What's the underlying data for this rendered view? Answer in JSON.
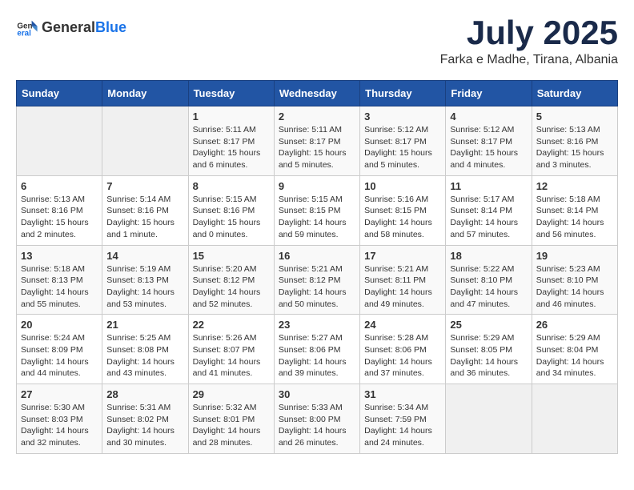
{
  "header": {
    "logo_general": "General",
    "logo_blue": "Blue",
    "month_title": "July 2025",
    "subtitle": "Farka e Madhe, Tirana, Albania"
  },
  "days_of_week": [
    "Sunday",
    "Monday",
    "Tuesday",
    "Wednesday",
    "Thursday",
    "Friday",
    "Saturday"
  ],
  "weeks": [
    [
      {
        "day": "",
        "info": ""
      },
      {
        "day": "",
        "info": ""
      },
      {
        "day": "1",
        "info": "Sunrise: 5:11 AM\nSunset: 8:17 PM\nDaylight: 15 hours\nand 6 minutes."
      },
      {
        "day": "2",
        "info": "Sunrise: 5:11 AM\nSunset: 8:17 PM\nDaylight: 15 hours\nand 5 minutes."
      },
      {
        "day": "3",
        "info": "Sunrise: 5:12 AM\nSunset: 8:17 PM\nDaylight: 15 hours\nand 5 minutes."
      },
      {
        "day": "4",
        "info": "Sunrise: 5:12 AM\nSunset: 8:17 PM\nDaylight: 15 hours\nand 4 minutes."
      },
      {
        "day": "5",
        "info": "Sunrise: 5:13 AM\nSunset: 8:16 PM\nDaylight: 15 hours\nand 3 minutes."
      }
    ],
    [
      {
        "day": "6",
        "info": "Sunrise: 5:13 AM\nSunset: 8:16 PM\nDaylight: 15 hours\nand 2 minutes."
      },
      {
        "day": "7",
        "info": "Sunrise: 5:14 AM\nSunset: 8:16 PM\nDaylight: 15 hours\nand 1 minute."
      },
      {
        "day": "8",
        "info": "Sunrise: 5:15 AM\nSunset: 8:16 PM\nDaylight: 15 hours\nand 0 minutes."
      },
      {
        "day": "9",
        "info": "Sunrise: 5:15 AM\nSunset: 8:15 PM\nDaylight: 14 hours\nand 59 minutes."
      },
      {
        "day": "10",
        "info": "Sunrise: 5:16 AM\nSunset: 8:15 PM\nDaylight: 14 hours\nand 58 minutes."
      },
      {
        "day": "11",
        "info": "Sunrise: 5:17 AM\nSunset: 8:14 PM\nDaylight: 14 hours\nand 57 minutes."
      },
      {
        "day": "12",
        "info": "Sunrise: 5:18 AM\nSunset: 8:14 PM\nDaylight: 14 hours\nand 56 minutes."
      }
    ],
    [
      {
        "day": "13",
        "info": "Sunrise: 5:18 AM\nSunset: 8:13 PM\nDaylight: 14 hours\nand 55 minutes."
      },
      {
        "day": "14",
        "info": "Sunrise: 5:19 AM\nSunset: 8:13 PM\nDaylight: 14 hours\nand 53 minutes."
      },
      {
        "day": "15",
        "info": "Sunrise: 5:20 AM\nSunset: 8:12 PM\nDaylight: 14 hours\nand 52 minutes."
      },
      {
        "day": "16",
        "info": "Sunrise: 5:21 AM\nSunset: 8:12 PM\nDaylight: 14 hours\nand 50 minutes."
      },
      {
        "day": "17",
        "info": "Sunrise: 5:21 AM\nSunset: 8:11 PM\nDaylight: 14 hours\nand 49 minutes."
      },
      {
        "day": "18",
        "info": "Sunrise: 5:22 AM\nSunset: 8:10 PM\nDaylight: 14 hours\nand 47 minutes."
      },
      {
        "day": "19",
        "info": "Sunrise: 5:23 AM\nSunset: 8:10 PM\nDaylight: 14 hours\nand 46 minutes."
      }
    ],
    [
      {
        "day": "20",
        "info": "Sunrise: 5:24 AM\nSunset: 8:09 PM\nDaylight: 14 hours\nand 44 minutes."
      },
      {
        "day": "21",
        "info": "Sunrise: 5:25 AM\nSunset: 8:08 PM\nDaylight: 14 hours\nand 43 minutes."
      },
      {
        "day": "22",
        "info": "Sunrise: 5:26 AM\nSunset: 8:07 PM\nDaylight: 14 hours\nand 41 minutes."
      },
      {
        "day": "23",
        "info": "Sunrise: 5:27 AM\nSunset: 8:06 PM\nDaylight: 14 hours\nand 39 minutes."
      },
      {
        "day": "24",
        "info": "Sunrise: 5:28 AM\nSunset: 8:06 PM\nDaylight: 14 hours\nand 37 minutes."
      },
      {
        "day": "25",
        "info": "Sunrise: 5:29 AM\nSunset: 8:05 PM\nDaylight: 14 hours\nand 36 minutes."
      },
      {
        "day": "26",
        "info": "Sunrise: 5:29 AM\nSunset: 8:04 PM\nDaylight: 14 hours\nand 34 minutes."
      }
    ],
    [
      {
        "day": "27",
        "info": "Sunrise: 5:30 AM\nSunset: 8:03 PM\nDaylight: 14 hours\nand 32 minutes."
      },
      {
        "day": "28",
        "info": "Sunrise: 5:31 AM\nSunset: 8:02 PM\nDaylight: 14 hours\nand 30 minutes."
      },
      {
        "day": "29",
        "info": "Sunrise: 5:32 AM\nSunset: 8:01 PM\nDaylight: 14 hours\nand 28 minutes."
      },
      {
        "day": "30",
        "info": "Sunrise: 5:33 AM\nSunset: 8:00 PM\nDaylight: 14 hours\nand 26 minutes."
      },
      {
        "day": "31",
        "info": "Sunrise: 5:34 AM\nSunset: 7:59 PM\nDaylight: 14 hours\nand 24 minutes."
      },
      {
        "day": "",
        "info": ""
      },
      {
        "day": "",
        "info": ""
      }
    ]
  ]
}
